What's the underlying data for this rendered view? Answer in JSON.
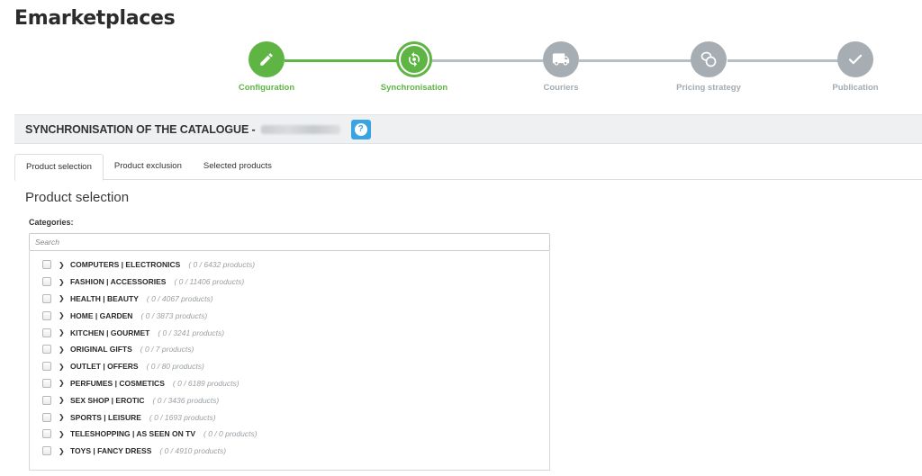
{
  "app": {
    "title": "Emarketplaces"
  },
  "stepper": {
    "steps": [
      {
        "label": "Configuration",
        "state": "done",
        "icon": "pencil-icon"
      },
      {
        "label": "Synchronisation",
        "state": "current",
        "icon": "sync-icon"
      },
      {
        "label": "Couriers",
        "state": "pending",
        "icon": "truck-icon"
      },
      {
        "label": "Pricing strategy",
        "state": "pending",
        "icon": "coins-icon"
      },
      {
        "label": "Publication",
        "state": "pending",
        "icon": "check-icon"
      }
    ]
  },
  "section": {
    "title": "SYNCHRONISATION OF THE CATALOGUE -",
    "help_icon": "question-icon"
  },
  "tabs": [
    {
      "label": "Product selection",
      "active": true
    },
    {
      "label": "Product exclusion",
      "active": false
    },
    {
      "label": "Selected products",
      "active": false
    }
  ],
  "panel": {
    "title": "Product selection",
    "categories_label": "Categories:",
    "search_placeholder": "Search"
  },
  "categories": [
    {
      "name": "COMPUTERS | ELECTRONICS",
      "count": "( 0 / 6432 products)"
    },
    {
      "name": "FASHION | ACCESSORIES",
      "count": "( 0 / 11406 products)"
    },
    {
      "name": "HEALTH | BEAUTY",
      "count": "( 0 / 4067 products)"
    },
    {
      "name": "HOME | GARDEN",
      "count": "( 0 / 3873 products)"
    },
    {
      "name": "KITCHEN | GOURMET",
      "count": "( 0 / 3241 products)"
    },
    {
      "name": "ORIGINAL GIFTS",
      "count": "( 0 / 7 products)"
    },
    {
      "name": "OUTLET | OFFERS",
      "count": "( 0 / 80 products)"
    },
    {
      "name": "PERFUMES | COSMETICS",
      "count": "( 0 / 6189 products)"
    },
    {
      "name": "SEX SHOP | EROTIC",
      "count": "( 0 / 3436 products)"
    },
    {
      "name": "SPORTS | LEISURE",
      "count": "( 0 / 1693 products)"
    },
    {
      "name": "TELESHOPPING | AS SEEN ON TV",
      "count": "( 0 / 0 products)"
    },
    {
      "name": "TOYS | FANCY DRESS",
      "count": "( 0 / 4910 products)"
    }
  ],
  "colors": {
    "accent": "#5fb544",
    "inactive": "#a6aeb4",
    "help": "#3aa3e3"
  }
}
